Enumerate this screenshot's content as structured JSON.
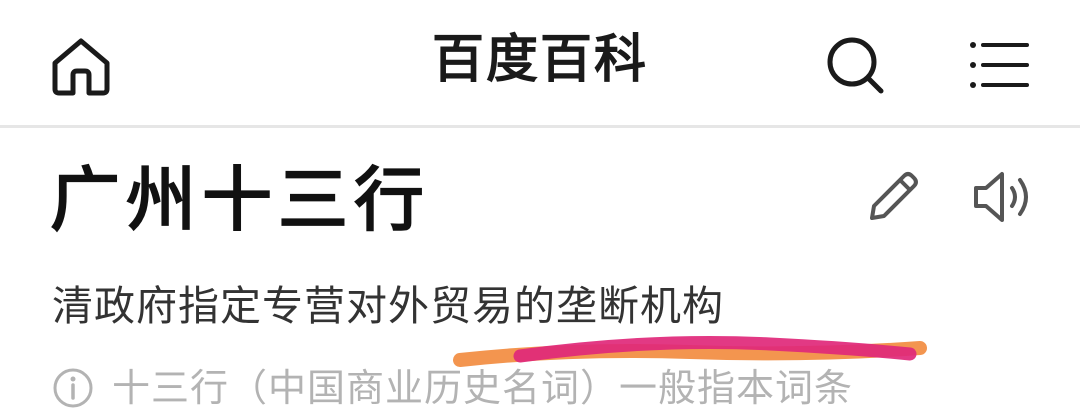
{
  "navbar": {
    "title": "百度百科",
    "home_icon": "home-icon",
    "search_icon": "search-icon",
    "menu_icon": "menu-icon"
  },
  "entry": {
    "title": "广州十三行",
    "description": "清政府指定专营对外贸易的垄断机构",
    "meta": "十三行（中国商业历史名词）一般指本词条",
    "edit_icon": "pencil-icon",
    "audio_icon": "speaker-icon",
    "info_icon": "info-icon"
  },
  "colors": {
    "text_primary": "#111111",
    "text_secondary": "#333333",
    "text_muted": "#b3b3b3",
    "divider": "#e6e6e6",
    "highlight_pink": "#e0287a",
    "highlight_orange": "#f28a3c"
  }
}
